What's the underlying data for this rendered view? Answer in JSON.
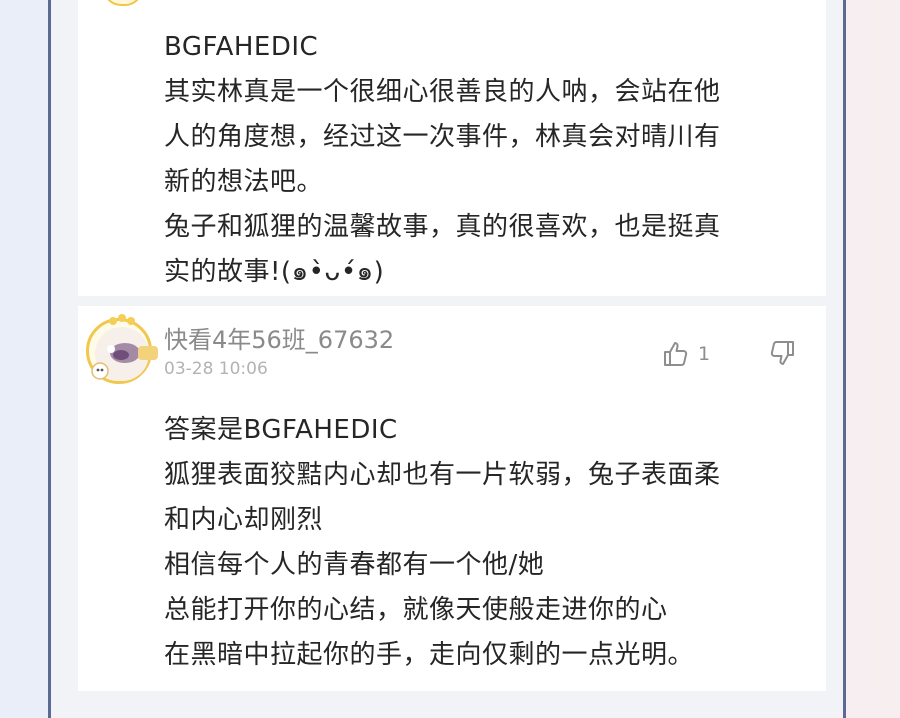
{
  "comments": [
    {
      "lines": [
        "BGFAHEDIC",
        "其实林真是一个很细心很善良的人呐，会站在他",
        "人的角度想，经过这一次事件，林真会对晴川有",
        "新的想法吧。",
        "兔子和狐狸的温馨故事，真的很喜欢，也是挺真",
        "实的故事!(๑•̀ᴗ•́๑)"
      ]
    },
    {
      "username": "快看4年56班_67632",
      "timestamp": "03-28 10:06",
      "likes": "1",
      "lines": [
        "答案是BGFAHEDIC",
        "狐狸表面狡黠内心却也有一片软弱，兔子表面柔",
        "和内心却刚烈",
        "相信每个人的青春都有一个他/她",
        "总能打开你的心结，就像天使般走进你的心",
        "在黑暗中拉起你的手，走向仅剩的一点光明。"
      ]
    }
  ],
  "icons": {
    "like": "thumbs-up-icon",
    "dislike": "thumbs-down-icon"
  },
  "colors": {
    "frame": "#5b6a94",
    "avatar_ring": "#f1c74d",
    "meta_text": "#8a8a8a"
  }
}
